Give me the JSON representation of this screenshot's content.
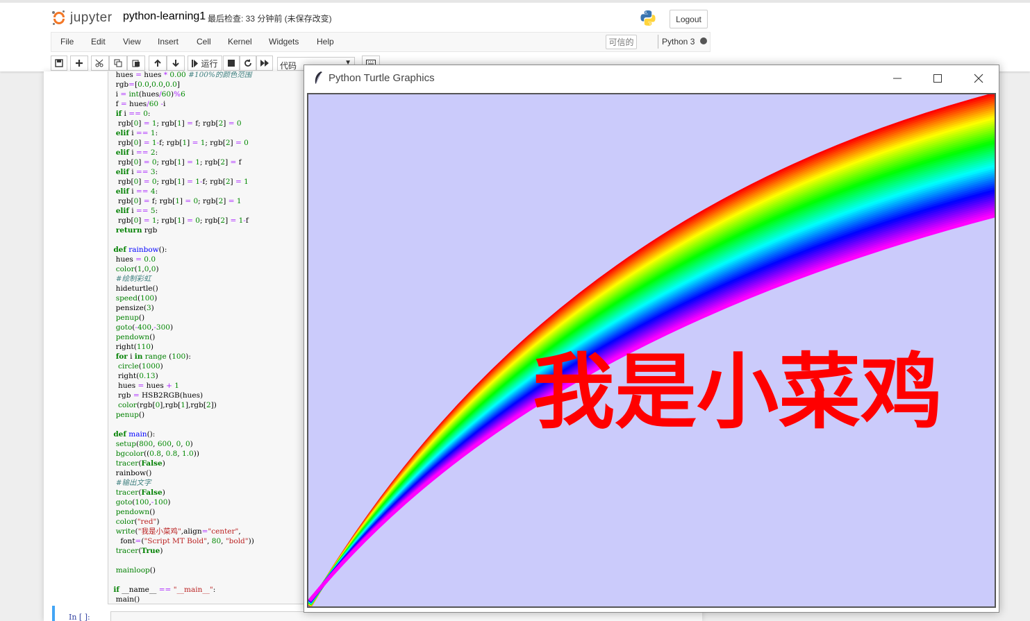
{
  "app": {
    "logo_text": "jupyter",
    "notebook_name": "python-learning1",
    "checkpoint_status": "最后检查: 33 分钟前  (未保存改变)",
    "logout_label": "Logout"
  },
  "menu": {
    "items": [
      "File",
      "Edit",
      "View",
      "Insert",
      "Cell",
      "Kernel",
      "Widgets",
      "Help"
    ],
    "trusted_label": "可信的",
    "kernel_name": "Python 3"
  },
  "toolbar": {
    "run_label": "运行",
    "cell_type": "代码"
  },
  "code_lines": [
    "  hues = hues * 0.00 #100%的颜色范围",
    "  rgb=[0.0,0.0,0.0]",
    "  i = int(hues/60)%6",
    "  f = hues/60 -i",
    "  if i == 0:",
    "   rgb[0] = 1; rgb[1] = f; rgb[2] = 0",
    "  elif i == 1:",
    "   rgb[0] = 1-f; rgb[1] = 1; rgb[2] = 0",
    "  elif i == 2:",
    "   rgb[0] = 0; rgb[1] = 1; rgb[2] = f",
    "  elif i == 3:",
    "   rgb[0] = 0; rgb[1] = 1-f; rgb[2] = 1",
    "  elif i == 4:",
    "   rgb[0] = f; rgb[1] = 0; rgb[2] = 1",
    "  elif i == 5:",
    "   rgb[0] = 1; rgb[1] = 0; rgb[2] = 1-f",
    "  return rgb",
    "",
    " def rainbow():",
    "  hues = 0.0",
    "  color(1,0,0)",
    "  #绘制彩虹",
    "  hideturtle()",
    "  speed(100)",
    "  pensize(3)",
    "  penup()",
    "  goto(-400,-300)",
    "  pendown()",
    "  right(110)",
    "  for i in range (100):",
    "   circle(1000)",
    "   right(0.13)",
    "   hues = hues + 1",
    "   rgb = HSB2RGB(hues)",
    "   color(rgb[0],rgb[1],rgb[2])",
    "  penup()",
    "",
    " def main():",
    "  setup(800, 600, 0, 0)",
    "  bgcolor((0.8, 0.8, 1.0))",
    "  tracer(False)",
    "  rainbow()",
    "  #输出文字",
    "  tracer(False)",
    "  goto(100,-100)",
    "  pendown()",
    "  color(\"red\")",
    "  write(\"我是小菜鸡\",align=\"center\",",
    "    font=(\"Script MT Bold\", 80, \"bold\"))",
    "  tracer(True)",
    "",
    "  mainloop()",
    "",
    " if __name__ == \"__main__\":",
    "  main()"
  ],
  "next_cell_prompt": "In  [ ]:",
  "turtle_window": {
    "title": "Python Turtle Graphics",
    "canvas_text": "我是小菜鸡",
    "canvas_text_color": "#ff0000",
    "background_color": "#cbcbfb"
  },
  "colors": {
    "jupyter_orange": "#f37726",
    "cell_selected_border": "#42a5f5"
  },
  "icons": [
    "jupyter-logo-icon",
    "python-logo-icon",
    "kernel-idle-icon",
    "save-icon",
    "add-cell-icon",
    "cut-icon",
    "copy-icon",
    "paste-icon",
    "move-up-icon",
    "move-down-icon",
    "run-icon",
    "stop-icon",
    "restart-icon",
    "fast-forward-icon",
    "keyboard-icon",
    "feather-icon",
    "minimize-icon",
    "maximize-icon",
    "close-icon"
  ]
}
